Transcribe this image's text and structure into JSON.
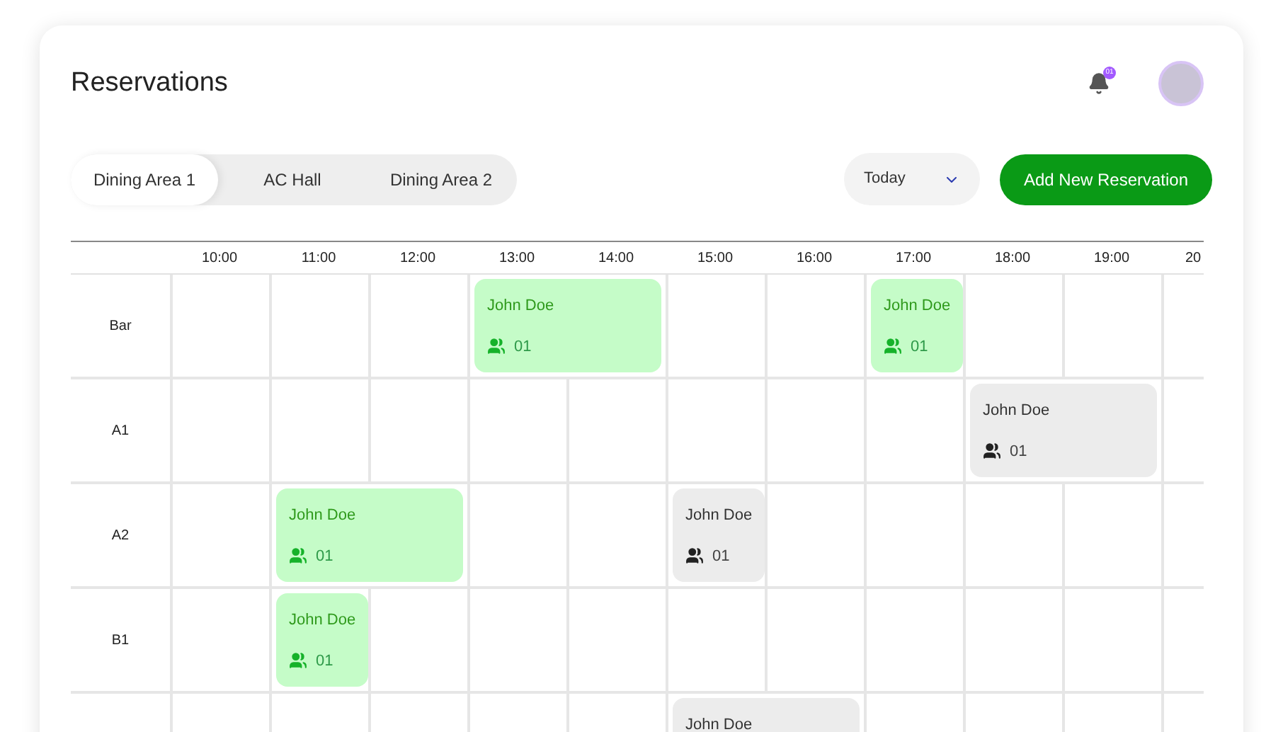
{
  "title": "Reservations",
  "notifications": {
    "badge": "01"
  },
  "tabs": [
    {
      "label": "Dining Area 1",
      "selected": true
    },
    {
      "label": "AC Hall",
      "selected": false
    },
    {
      "label": "Dining Area 2",
      "selected": false
    }
  ],
  "date_filter": {
    "value": "Today"
  },
  "add_button": "Add New Reservation",
  "columns": [
    "10:00",
    "11:00",
    "12:00",
    "13:00",
    "14:00",
    "15:00",
    "16:00",
    "17:00",
    "18:00",
    "19:00",
    "20"
  ],
  "rows": [
    {
      "label": "Bar",
      "slots": [
        {
          "kind": "free"
        },
        {
          "kind": "free"
        },
        {
          "kind": "free"
        },
        {
          "kind": "booking",
          "wide": true,
          "confirmed": true,
          "name": "John Doe",
          "guests": "01"
        },
        {
          "kind": "covered"
        },
        {
          "kind": "free"
        },
        {
          "kind": "free"
        },
        {
          "kind": "booking",
          "wide": false,
          "confirmed": true,
          "name": "John Doe",
          "guests": "01"
        },
        {
          "kind": "free"
        },
        {
          "kind": "free"
        },
        {
          "kind": "free"
        }
      ]
    },
    {
      "label": "A1",
      "slots": [
        {
          "kind": "free"
        },
        {
          "kind": "free"
        },
        {
          "kind": "free"
        },
        {
          "kind": "free"
        },
        {
          "kind": "free"
        },
        {
          "kind": "free"
        },
        {
          "kind": "free"
        },
        {
          "kind": "free"
        },
        {
          "kind": "booking",
          "wide": true,
          "confirmed": false,
          "name": "John Doe",
          "guests": "01"
        },
        {
          "kind": "covered"
        },
        {
          "kind": "free"
        }
      ]
    },
    {
      "label": "A2",
      "slots": [
        {
          "kind": "free"
        },
        {
          "kind": "booking",
          "wide": true,
          "confirmed": true,
          "name": "John Doe",
          "guests": "01"
        },
        {
          "kind": "covered"
        },
        {
          "kind": "free"
        },
        {
          "kind": "free"
        },
        {
          "kind": "booking",
          "wide": false,
          "confirmed": false,
          "name": "John Doe",
          "guests": "01"
        },
        {
          "kind": "free"
        },
        {
          "kind": "free"
        },
        {
          "kind": "free"
        },
        {
          "kind": "free"
        },
        {
          "kind": "free"
        }
      ]
    },
    {
      "label": "B1",
      "slots": [
        {
          "kind": "free"
        },
        {
          "kind": "booking",
          "wide": false,
          "confirmed": true,
          "name": "John Doe",
          "guests": "01"
        },
        {
          "kind": "free"
        },
        {
          "kind": "free"
        },
        {
          "kind": "free"
        },
        {
          "kind": "free"
        },
        {
          "kind": "free"
        },
        {
          "kind": "free"
        },
        {
          "kind": "free"
        },
        {
          "kind": "free"
        },
        {
          "kind": "free"
        }
      ]
    },
    {
      "slots": [
        {
          "kind": "free"
        },
        {
          "kind": "free"
        },
        {
          "kind": "free"
        },
        {
          "kind": "free"
        },
        {
          "kind": "free"
        },
        {
          "kind": "booking",
          "wide": true,
          "confirmed": false,
          "name": "John Doe"
        },
        {
          "kind": "covered"
        },
        {
          "kind": "free"
        },
        {
          "kind": "free"
        },
        {
          "kind": "free"
        },
        {
          "kind": "free"
        }
      ]
    }
  ]
}
